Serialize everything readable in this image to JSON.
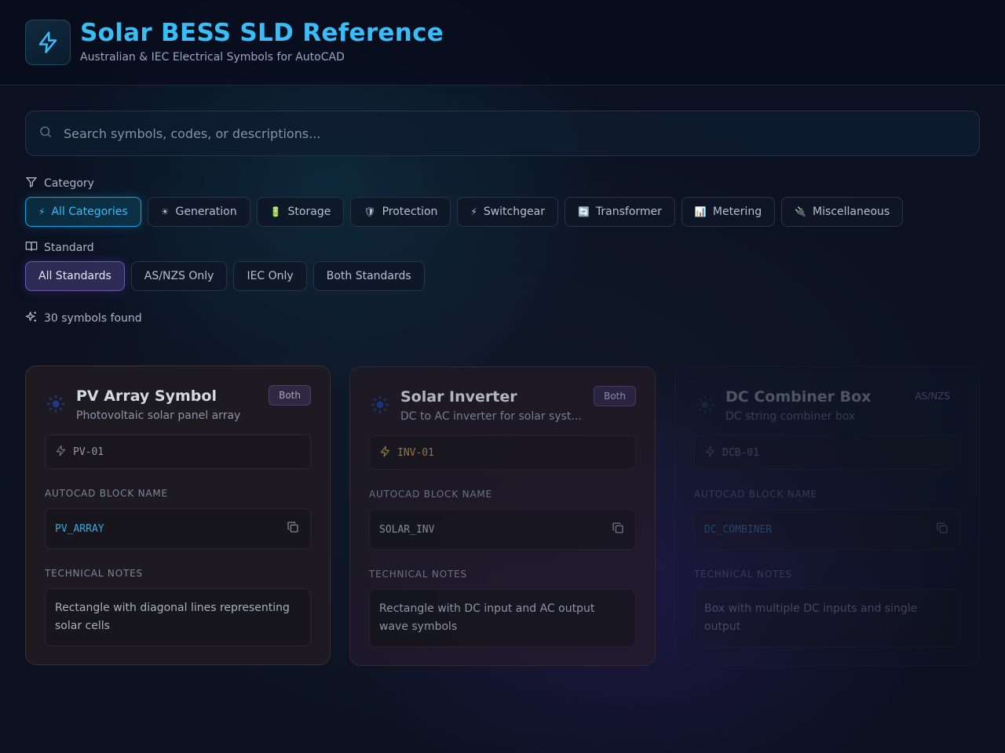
{
  "header": {
    "title": "Solar BESS SLD Reference",
    "subtitle": "Australian & IEC Electrical Symbols for AutoCAD",
    "logo_icon": "lightning-icon"
  },
  "search": {
    "placeholder": "Search symbols, codes, or descriptions...",
    "value": ""
  },
  "category": {
    "label": "Category",
    "options": [
      {
        "label": "All Categories",
        "icon": "⚡",
        "active": true
      },
      {
        "label": "Generation",
        "icon": "☀",
        "active": false
      },
      {
        "label": "Storage",
        "icon": "🔋",
        "active": false
      },
      {
        "label": "Protection",
        "icon": "🛡",
        "active": false
      },
      {
        "label": "Switchgear",
        "icon": "⚡",
        "active": false
      },
      {
        "label": "Transformer",
        "icon": "🔄",
        "active": false
      },
      {
        "label": "Metering",
        "icon": "📊",
        "active": false
      },
      {
        "label": "Miscellaneous",
        "icon": "🔌",
        "active": false
      }
    ]
  },
  "standard": {
    "label": "Standard",
    "options": [
      {
        "label": "All Standards",
        "active": true
      },
      {
        "label": "AS/NZS Only",
        "active": false
      },
      {
        "label": "IEC Only",
        "active": false
      },
      {
        "label": "Both Standards",
        "active": false
      }
    ]
  },
  "results": {
    "count_text": "30 symbols found"
  },
  "labels": {
    "block_name": "AUTOCAD BLOCK NAME",
    "notes": "TECHNICAL NOTES"
  },
  "cards": [
    {
      "title": "PV Array Symbol",
      "description": "Photovoltaic solar panel array",
      "badge": "Both",
      "code": "PV-01",
      "block": "PV_ARRAY",
      "notes": "Rectangle with diagonal lines representing solar cells"
    },
    {
      "title": "Solar Inverter",
      "description": "DC to AC inverter for solar syst...",
      "badge": "Both",
      "code": "INV-01",
      "block": "SOLAR_INV",
      "notes": "Rectangle with DC input and AC output wave symbols"
    },
    {
      "title": "DC Combiner Box",
      "description": "DC string combiner box",
      "badge": "AS/NZS",
      "code": "DCB-01",
      "block": "DC_COMBINER",
      "notes": "Box with multiple DC inputs and single output"
    }
  ],
  "colors": {
    "accent": "#38bdf8",
    "background": "#0b1120",
    "standard_active": "#6d5ca8"
  }
}
